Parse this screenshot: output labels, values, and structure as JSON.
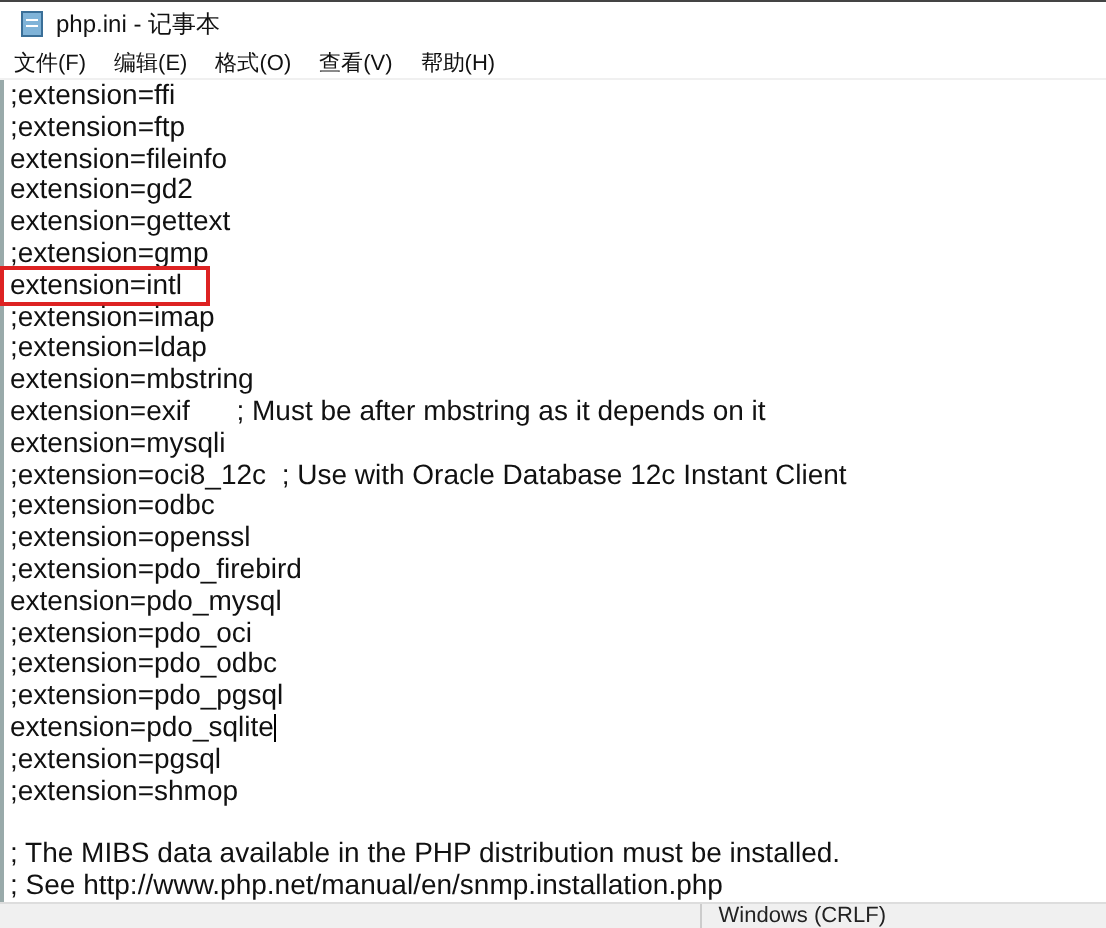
{
  "window": {
    "title": "php.ini - 记事本"
  },
  "menu": [
    "文件(F)",
    "编辑(E)",
    "格式(O)",
    "查看(V)",
    "帮助(H)"
  ],
  "lines": [
    {
      "kind": "text",
      "text": ";extension=ffi",
      "boxed": false,
      "cursor": false
    },
    {
      "kind": "text",
      "text": ";extension=ftp",
      "boxed": false,
      "cursor": false
    },
    {
      "kind": "text",
      "text": "extension=fileinfo",
      "boxed": false,
      "cursor": false
    },
    {
      "kind": "text",
      "text": "extension=gd2",
      "boxed": false,
      "cursor": false
    },
    {
      "kind": "text",
      "text": "extension=gettext",
      "boxed": false,
      "cursor": false
    },
    {
      "kind": "text",
      "text": ";extension=gmp",
      "boxed": false,
      "cursor": false
    },
    {
      "kind": "text",
      "text": "extension=intl",
      "boxed": true,
      "cursor": false
    },
    {
      "kind": "text",
      "text": ";extension=imap",
      "boxed": false,
      "cursor": false
    },
    {
      "kind": "text",
      "text": ";extension=ldap",
      "boxed": false,
      "cursor": false
    },
    {
      "kind": "text",
      "text": "extension=mbstring",
      "boxed": false,
      "cursor": false
    },
    {
      "kind": "text",
      "text": "extension=exif      ; Must be after mbstring as it depends on it",
      "boxed": false,
      "cursor": false
    },
    {
      "kind": "text",
      "text": "extension=mysqli",
      "boxed": false,
      "cursor": false
    },
    {
      "kind": "text",
      "text": ";extension=oci8_12c  ; Use with Oracle Database 12c Instant Client",
      "boxed": false,
      "cursor": false
    },
    {
      "kind": "text",
      "text": ";extension=odbc",
      "boxed": false,
      "cursor": false
    },
    {
      "kind": "text",
      "text": ";extension=openssl",
      "boxed": false,
      "cursor": false
    },
    {
      "kind": "text",
      "text": ";extension=pdo_firebird",
      "boxed": false,
      "cursor": false
    },
    {
      "kind": "text",
      "text": "extension=pdo_mysql",
      "boxed": false,
      "cursor": false
    },
    {
      "kind": "text",
      "text": ";extension=pdo_oci",
      "boxed": false,
      "cursor": false
    },
    {
      "kind": "text",
      "text": ";extension=pdo_odbc",
      "boxed": false,
      "cursor": false
    },
    {
      "kind": "text",
      "text": ";extension=pdo_pgsql",
      "boxed": false,
      "cursor": false
    },
    {
      "kind": "text",
      "text": "extension=pdo_sqlite",
      "boxed": false,
      "cursor": true
    },
    {
      "kind": "text",
      "text": ";extension=pgsql",
      "boxed": false,
      "cursor": false
    },
    {
      "kind": "text",
      "text": ";extension=shmop",
      "boxed": false,
      "cursor": false
    },
    {
      "kind": "blank"
    },
    {
      "kind": "text",
      "text": "; The MIBS data available in the PHP distribution must be installed.",
      "boxed": false,
      "cursor": false
    },
    {
      "kind": "text",
      "text": "; See http://www.php.net/manual/en/snmp.installation.php",
      "boxed": false,
      "cursor": false
    }
  ],
  "status_bar": {
    "line_ending": "Windows (CRLF)"
  }
}
